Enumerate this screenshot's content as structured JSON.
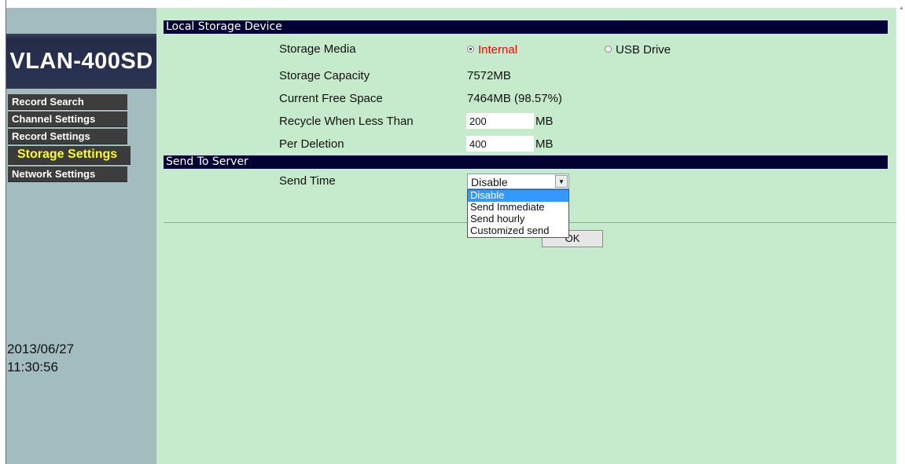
{
  "sidebar": {
    "logo": "VLAN-400SD",
    "nav": [
      {
        "label": "Record Search",
        "active": false
      },
      {
        "label": "Channel Settings",
        "active": false
      },
      {
        "label": "Record Settings",
        "active": false
      },
      {
        "label": "Storage Settings",
        "active": true
      },
      {
        "label": "Network Settings",
        "active": false
      }
    ],
    "date": "2013/06/27",
    "time": "11:30:56"
  },
  "local_storage": {
    "header": "Local Storage Device",
    "media_label": "Storage Media",
    "media_options": [
      "Internal",
      "USB Drive"
    ],
    "media_selected": "Internal",
    "capacity_label": "Storage Capacity",
    "capacity_value": "7572MB",
    "free_label": "Current Free Space",
    "free_value": "7464MB (98.57%)",
    "recycle_label": "Recycle When Less Than",
    "recycle_value": "200",
    "recycle_unit": "MB",
    "deletion_label": "Per Deletion",
    "deletion_value": "400",
    "deletion_unit": "MB"
  },
  "send_to_server": {
    "header": "Send To Server",
    "send_time_label": "Send Time",
    "send_time_value": "Disable",
    "options": [
      "Disable",
      "Send Immediate",
      "Send hourly",
      "Customized send"
    ]
  },
  "ok_label": "OK",
  "colors": {
    "sidebar_bg": "#a3bcbf",
    "main_bg": "#c5ebcc",
    "header_bg": "#000033",
    "active_nav_text": "#ffff22",
    "selected_radio_text": "#ff0000",
    "dropdown_highlight": "#3399ff"
  }
}
